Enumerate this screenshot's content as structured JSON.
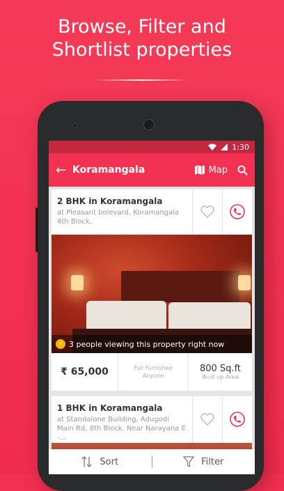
{
  "promo": {
    "headline": "Browse, Filter and\nShortlist properties"
  },
  "status_bar": {
    "time": "1:30"
  },
  "app_bar": {
    "back_icon": "arrow-left-icon",
    "title": "Koramangala",
    "map_label": "Map",
    "map_icon": "map-icon",
    "search_icon": "search-icon"
  },
  "listings": [
    {
      "title": "2 BHK in Koramangala",
      "address": "at Pleasant bolevard, Koramangala 4th Block,",
      "viewing_text": "3 people viewing this property right now",
      "price": "₹ 65,000",
      "furnishing_line1": "Full Furnished",
      "furnishing_line2": "Anyone",
      "area": "800 Sq.ft",
      "area_label": "Built up Area"
    },
    {
      "title": "1 BHK in Koramangala",
      "address": "at Standalone Building, Adugodi Main Rd, 8th Block, Near Narayana E -..."
    }
  ],
  "bottom_bar": {
    "sort_label": "Sort",
    "filter_label": "Filter"
  },
  "colors": {
    "brand": "#f2304f",
    "status_bar": "#c42840"
  }
}
